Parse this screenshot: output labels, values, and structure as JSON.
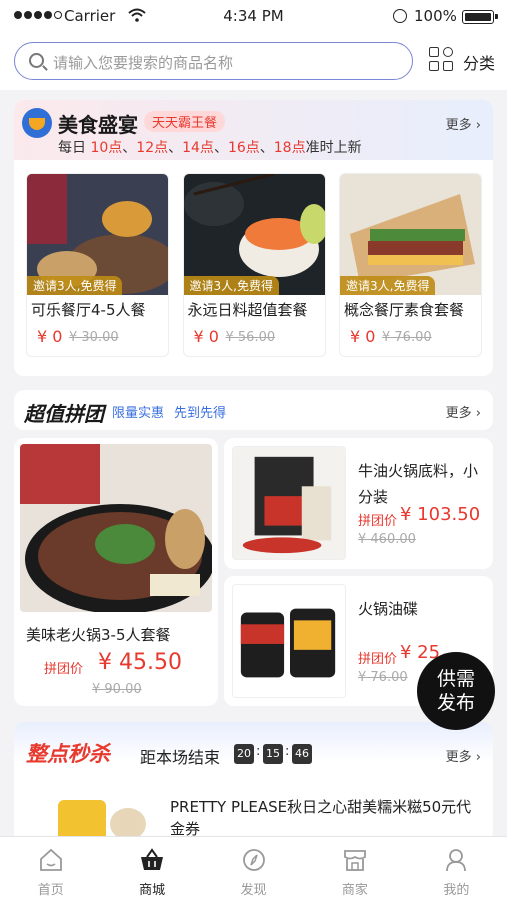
{
  "status_bar": {
    "carrier": "Carrier",
    "time": "4:34 PM",
    "battery": "100%"
  },
  "search": {
    "placeholder": "请输入您要搜索的商品名称"
  },
  "category": {
    "label": "分类"
  },
  "food_feast": {
    "title": "美食盛宴",
    "badge": "天天霸王餐",
    "more": "更多",
    "schedule_prefix": "每日",
    "times": [
      "10点",
      "12点",
      "14点",
      "16点",
      "18点"
    ],
    "schedule_suffix": "准时上新",
    "items": [
      {
        "tag": "邀请3人,免费得",
        "name": "可乐餐厅4-5人餐",
        "price": "¥ 0",
        "original": "¥ 30.00"
      },
      {
        "tag": "邀请3人,免费得",
        "name": "永远日料超值套餐",
        "price": "¥ 0",
        "original": "¥ 56.00"
      },
      {
        "tag": "邀请3人,免费得",
        "name": "概念餐厅素食套餐",
        "price": "¥ 0",
        "original": "¥ 76.00"
      }
    ]
  },
  "group_buy": {
    "title": "超值拼团",
    "sub1": "限量实惠",
    "sub2": "先到先得",
    "more": "更多",
    "featured": {
      "name": "美味老火锅3-5人套餐",
      "price_label": "拼团价",
      "price": "¥ 45.50",
      "original": "¥ 90.00"
    },
    "items": [
      {
        "name": "牛油火锅底料，小分装",
        "price_label": "拼团价",
        "price": "¥ 103.50",
        "original": "¥ 460.00"
      },
      {
        "name": "火锅油碟",
        "price_label": "拼团价",
        "price": "¥ 25",
        "original": "¥ 76.00"
      }
    ]
  },
  "fab": {
    "line1": "供需",
    "line2": "发布"
  },
  "flash_sale": {
    "title": "整点秒杀",
    "countdown_label": "距本场结束",
    "countdown": [
      "20",
      "15",
      "46"
    ],
    "more": "更多",
    "item_desc": "PRETTY PLEASE秋日之心甜美糯米糍50元代金券"
  },
  "tabbar": [
    {
      "label": "首页",
      "icon": "home-icon",
      "active": false
    },
    {
      "label": "商城",
      "icon": "shop-basket-icon",
      "active": true
    },
    {
      "label": "发现",
      "icon": "compass-icon",
      "active": false
    },
    {
      "label": "商家",
      "icon": "store-icon",
      "active": false
    },
    {
      "label": "我的",
      "icon": "profile-icon",
      "active": false
    }
  ],
  "colors": {
    "accent_red": "#e8392f",
    "accent_blue": "#3b6fe0",
    "search_border": "#7a86d8"
  }
}
